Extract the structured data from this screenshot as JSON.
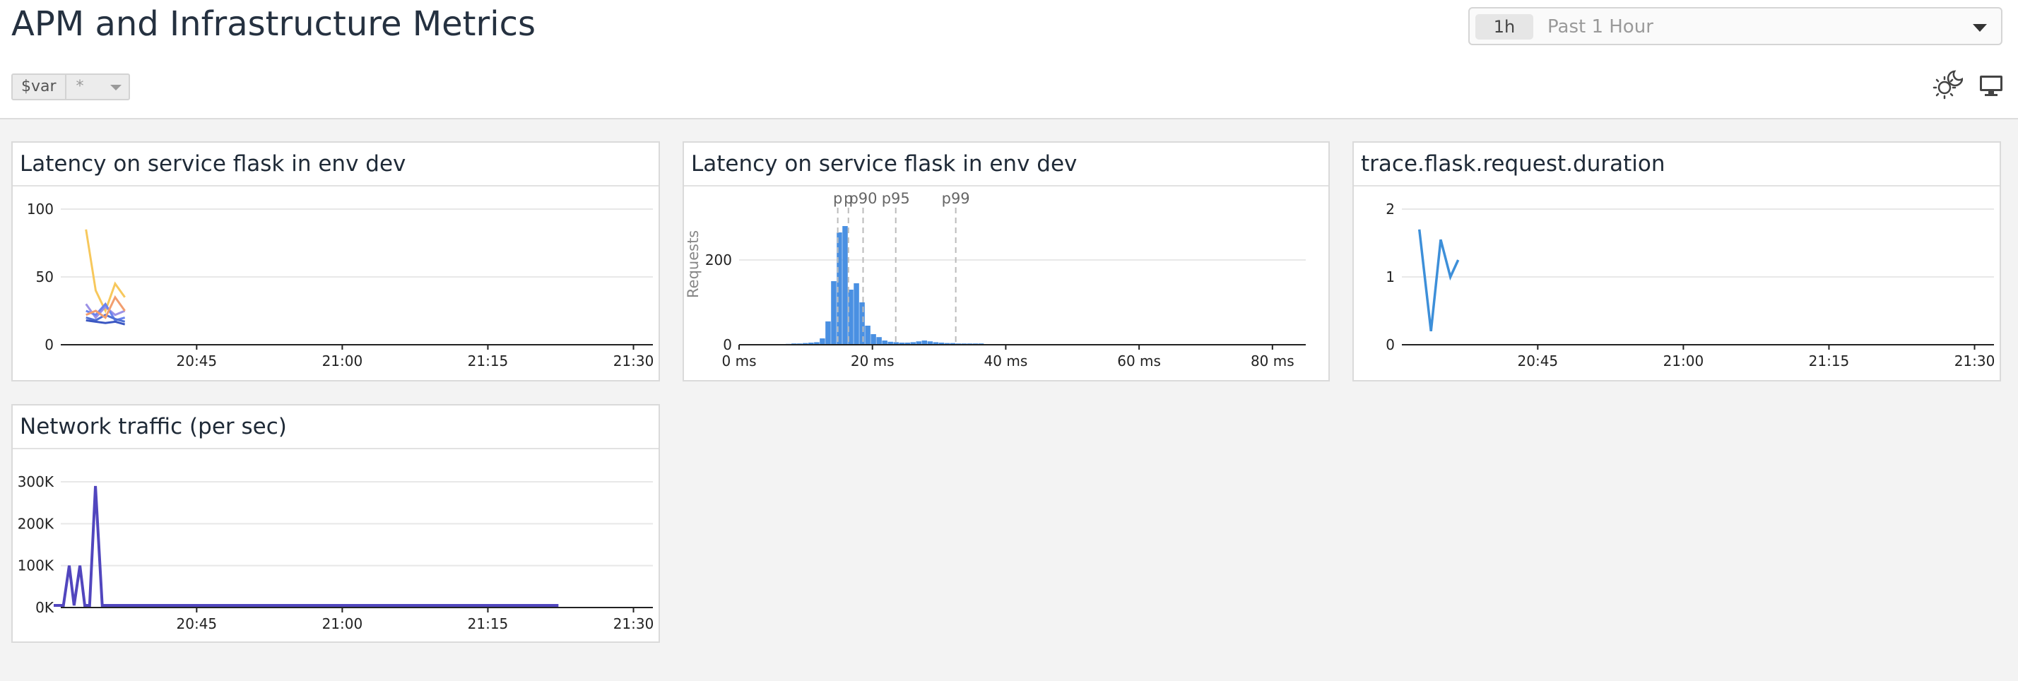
{
  "dashboard": {
    "title": "APM and Infrastructure Metrics",
    "time": {
      "badge": "1h",
      "label": "Past 1 Hour"
    },
    "template_var": {
      "name": "$var",
      "value": "*"
    },
    "icons": {
      "theme": "theme-toggle-icon",
      "tv": "tv-mode-icon"
    }
  },
  "widgets": [
    {
      "title": "Latency on service flask in env dev"
    },
    {
      "title": "Latency on service flask in env dev"
    },
    {
      "title": "trace.flask.request.duration"
    },
    {
      "title": "Network traffic (per sec)"
    }
  ],
  "colors": {
    "grid": "#e8e8e8",
    "axis": "#222222",
    "tick_text": "#222222",
    "hist_bar": "#4a90e2",
    "trace_line": "#3d8fd9",
    "network_line": "#5146be",
    "latency_series": [
      "#f7c85c",
      "#9b91e6",
      "#6a84ee",
      "#4e6fd4",
      "#3b57c2",
      "#f29e6f"
    ]
  },
  "chart_data": [
    {
      "type": "line",
      "title": "Latency on service flask in env dev",
      "x_ticks": [
        "20:45",
        "21:00",
        "21:15",
        "21:30"
      ],
      "y_ticks": [
        "100",
        "50",
        "0"
      ],
      "ylim": [
        0,
        100
      ],
      "x_minutes": [
        0,
        1,
        2,
        3,
        4
      ],
      "series": [
        {
          "values": [
            85,
            40,
            25,
            45,
            35
          ]
        },
        {
          "values": [
            30,
            20,
            28,
            22,
            25
          ]
        },
        {
          "values": [
            25,
            22,
            30,
            18,
            20
          ]
        },
        {
          "values": [
            20,
            18,
            22,
            19,
            17
          ]
        },
        {
          "values": [
            18,
            17,
            16,
            17,
            15
          ]
        },
        {
          "values": [
            22,
            25,
            20,
            35,
            25
          ]
        }
      ]
    },
    {
      "type": "bar",
      "title": "Latency on service flask in env dev",
      "ylabel": "Requests",
      "x_ticks": [
        "0 ms",
        "20 ms",
        "40 ms",
        "60 ms",
        "80 ms"
      ],
      "y_ticks": [
        "200",
        "0"
      ],
      "ylim": [
        0,
        320
      ],
      "xlim": [
        0,
        85
      ],
      "bins_start_ms": 7,
      "bin_width_ms": 0.85,
      "counts": [
        2,
        3,
        3,
        4,
        5,
        6,
        15,
        55,
        150,
        265,
        280,
        130,
        145,
        100,
        45,
        25,
        18,
        10,
        7,
        6,
        5,
        5,
        6,
        8,
        10,
        8,
        6,
        5,
        4,
        4,
        3,
        3,
        3,
        3,
        3
      ],
      "percentiles": [
        {
          "label": "p",
          "value": 14.8
        },
        {
          "label": "p",
          "value": 16.4
        },
        {
          "label": "p90",
          "value": 18.6
        },
        {
          "label": "p95",
          "value": 23.5
        },
        {
          "label": "p99",
          "value": 32.5
        }
      ]
    },
    {
      "type": "line",
      "title": "trace.flask.request.duration",
      "x_ticks": [
        "20:45",
        "21:00",
        "21:15",
        "21:30"
      ],
      "y_ticks": [
        "2",
        "1",
        "0"
      ],
      "ylim": [
        0,
        2
      ],
      "x_minutes": [
        0,
        1.2,
        2.2,
        3.2,
        4
      ],
      "values": [
        1.7,
        0.2,
        1.55,
        1.0,
        1.25
      ]
    },
    {
      "type": "line",
      "title": "Network traffic (per sec)",
      "x_ticks": [
        "20:45",
        "21:00",
        "21:15",
        "21:30"
      ],
      "y_ticks": [
        "300K",
        "200K",
        "100K",
        "0K"
      ],
      "ylim": [
        0,
        300000
      ],
      "x_minutes": [
        0,
        1,
        1.6,
        2.1,
        2.7,
        3.2,
        3.7,
        4.3,
        5,
        10,
        20,
        30,
        40,
        52
      ],
      "values": [
        5000,
        5000,
        100000,
        5000,
        100000,
        5000,
        5000,
        290000,
        5000,
        5000,
        5000,
        5000,
        5000,
        5000
      ]
    }
  ]
}
